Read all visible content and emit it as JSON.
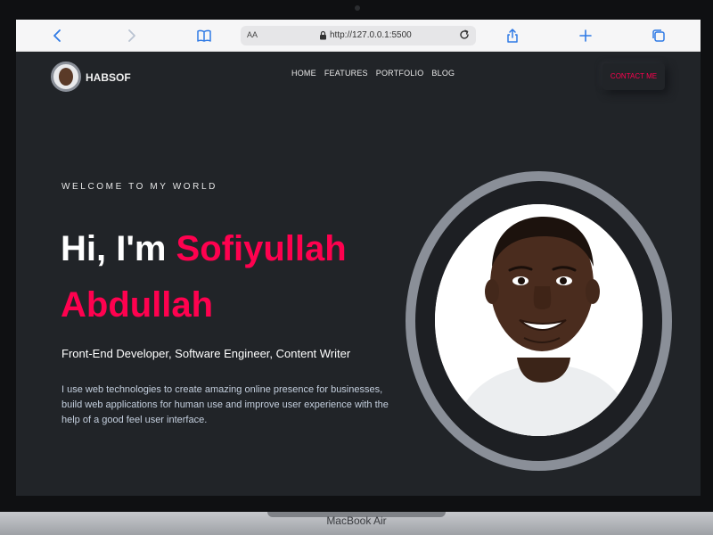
{
  "browser": {
    "aa_label": "AA",
    "url": "http://127.0.0.1:5500",
    "icons": [
      "back-icon",
      "forward-icon",
      "bookmarks-icon",
      "lock-icon",
      "reload-icon",
      "share-icon",
      "new-tab-icon",
      "tabs-icon"
    ],
    "accent": "#2f7ae5"
  },
  "site": {
    "brand": "HABSOF",
    "nav": [
      "HOME",
      "FEATURES",
      "PORTFOLIO",
      "BLOG"
    ],
    "contact_label": "CONTACT ME"
  },
  "hero": {
    "eyebrow": "WELCOME TO MY WORLD",
    "greeting": "Hi, I'm ",
    "name_first": "Sofiyullah",
    "name_last": "Abdullah",
    "roles": "Front-End Developer, Software Engineer, Content Writer",
    "bio": "I use web technologies to create amazing online presence for businesses, build web applications for human use and improve user experience with the help of a good feel user interface."
  },
  "device": {
    "label": "MacBook Air"
  },
  "colors": {
    "background": "#212428",
    "accent": "#ff014f",
    "text": "#ffffff",
    "muted": "#c4cfde"
  }
}
